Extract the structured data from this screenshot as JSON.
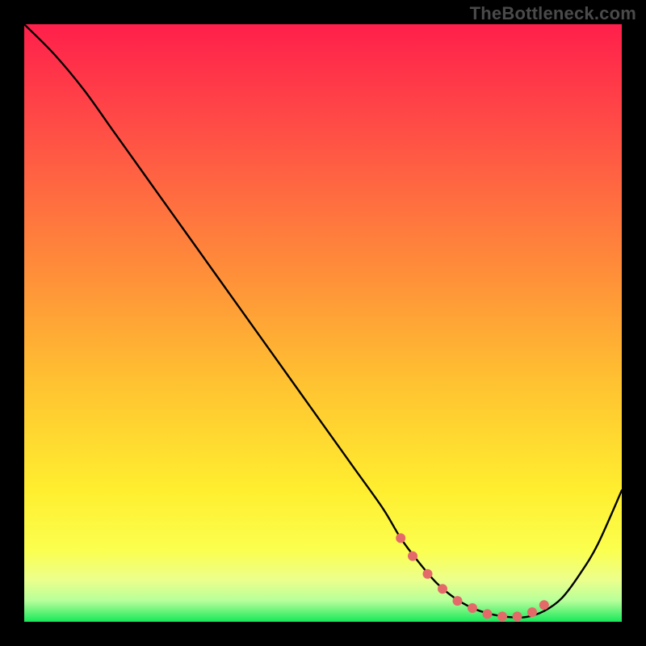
{
  "watermark": "TheBottleneck.com",
  "chart_data": {
    "type": "line",
    "title": "",
    "xlabel": "",
    "ylabel": "",
    "xlim": [
      0,
      100
    ],
    "ylim": [
      0,
      100
    ],
    "grid": false,
    "legend": false,
    "annotations": [],
    "gradient_stops": [
      {
        "offset": 0.0,
        "color": "#ff1f4b"
      },
      {
        "offset": 0.18,
        "color": "#ff4f46"
      },
      {
        "offset": 0.4,
        "color": "#ff8a3a"
      },
      {
        "offset": 0.6,
        "color": "#ffc231"
      },
      {
        "offset": 0.78,
        "color": "#ffee2f"
      },
      {
        "offset": 0.88,
        "color": "#fbff4e"
      },
      {
        "offset": 0.93,
        "color": "#ecff8c"
      },
      {
        "offset": 0.965,
        "color": "#b7ff9a"
      },
      {
        "offset": 1.0,
        "color": "#17e859"
      }
    ],
    "series": [
      {
        "name": "bottleneck-curve",
        "x": [
          0,
          5,
          10,
          15,
          20,
          25,
          30,
          35,
          40,
          45,
          50,
          55,
          60,
          63,
          66,
          69,
          72,
          75,
          78,
          81,
          84,
          87,
          90,
          93,
          96,
          100
        ],
        "values": [
          100,
          95,
          89,
          82,
          75,
          68,
          61,
          54,
          47,
          40,
          33,
          26,
          19,
          14,
          10,
          6.5,
          4,
          2.3,
          1.3,
          0.8,
          0.8,
          1.8,
          4,
          8,
          13,
          22
        ]
      }
    ],
    "highlight_dots": {
      "name": "optimal-range",
      "color": "#e46a6a",
      "radius": 6,
      "x": [
        63,
        65,
        67.5,
        70,
        72.5,
        75,
        77.5,
        80,
        82.5,
        85,
        87
      ],
      "values": [
        14,
        11,
        8,
        5.5,
        3.5,
        2.3,
        1.3,
        0.9,
        0.9,
        1.6,
        2.8
      ]
    }
  }
}
